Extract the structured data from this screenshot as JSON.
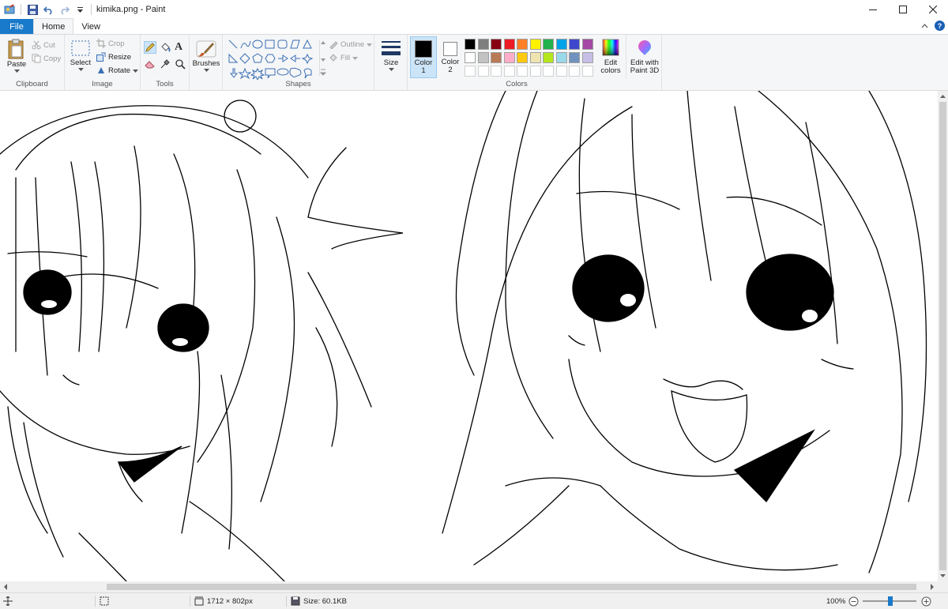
{
  "window": {
    "title": "kimika.png - Paint"
  },
  "tabs": {
    "file": "File",
    "home": "Home",
    "view": "View"
  },
  "clipboard": {
    "paste": "Paste",
    "cut": "Cut",
    "copy": "Copy",
    "group": "Clipboard"
  },
  "image": {
    "select": "Select",
    "crop": "Crop",
    "resize": "Resize",
    "rotate": "Rotate",
    "group": "Image"
  },
  "tools": {
    "group": "Tools"
  },
  "brushes": {
    "label": "Brushes"
  },
  "shapes": {
    "outline": "Outline",
    "fill": "Fill",
    "group": "Shapes"
  },
  "size": {
    "label": "Size"
  },
  "colors": {
    "color1_line1": "Color",
    "color1_line2": "1",
    "color2_line1": "Color",
    "color2_line2": "2",
    "edit_line1": "Edit",
    "edit_line2": "colors",
    "paint3d_line1": "Edit with",
    "paint3d_line2": "Paint 3D",
    "group": "Colors",
    "color1_value": "#000000",
    "color2_value": "#ffffff",
    "palette_row1": [
      "#000000",
      "#7f7f7f",
      "#880015",
      "#ed1c24",
      "#ff7f27",
      "#fff200",
      "#22b14c",
      "#00a2e8",
      "#3f48cc",
      "#a349a4"
    ],
    "palette_row2": [
      "#ffffff",
      "#c3c3c3",
      "#b97a57",
      "#ffaec9",
      "#ffc90e",
      "#efe4b0",
      "#b5e61d",
      "#99d9ea",
      "#7092be",
      "#c8bfe7"
    ]
  },
  "status": {
    "dimensions": "1712 × 802px",
    "size": "Size: 60.1KB",
    "zoom": "100%"
  }
}
